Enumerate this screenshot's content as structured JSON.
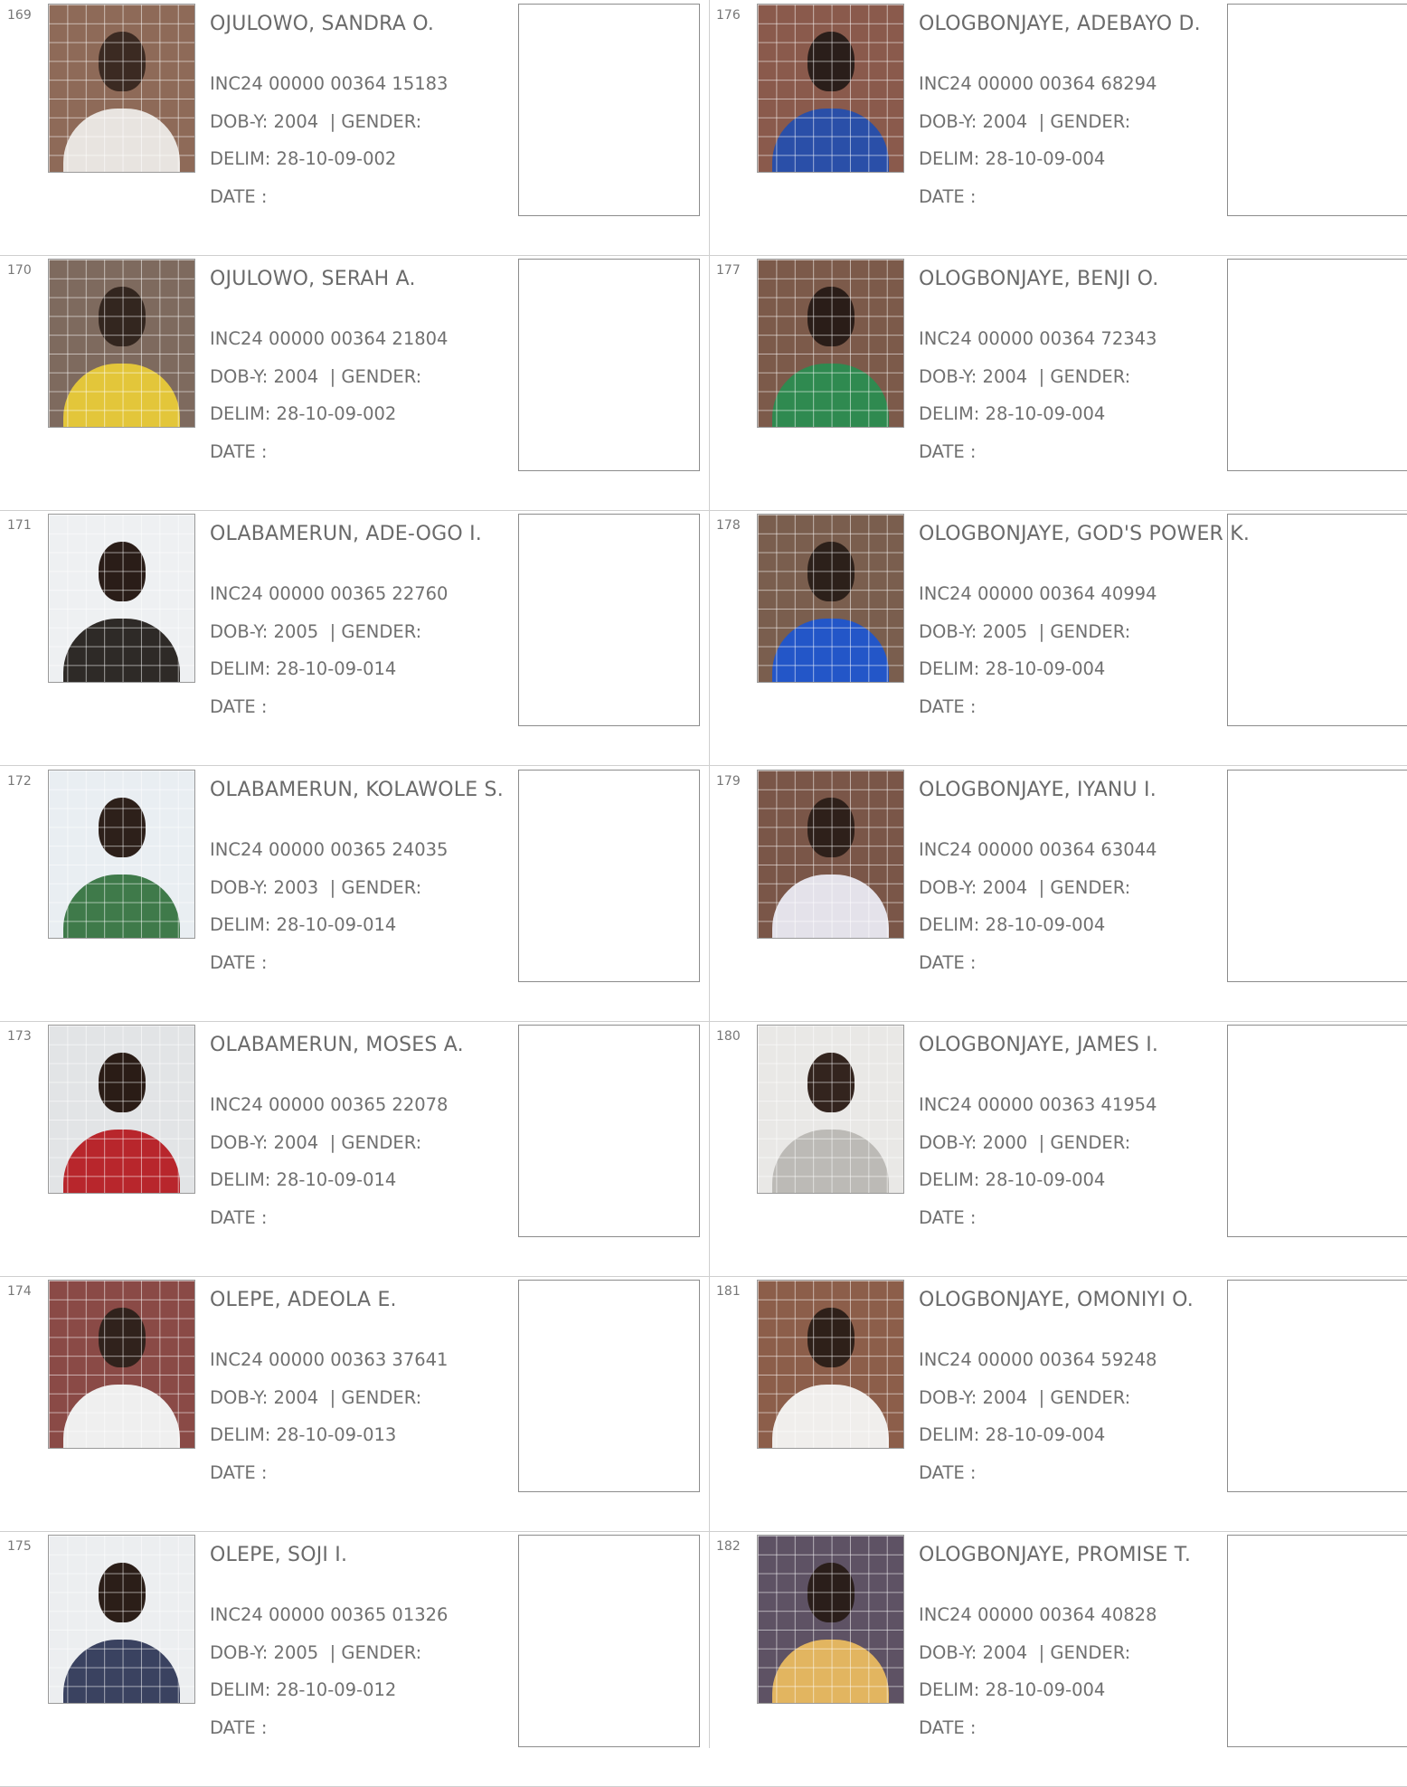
{
  "labels": {
    "dob_prefix": "DOB-Y: ",
    "gender_label": "| GENDER:",
    "delim_prefix": "DELIM: ",
    "date_label": "DATE  :"
  },
  "left_column": [
    {
      "serial": "169",
      "name": "OJULOWO, SANDRA O.",
      "vin": "INC24 00000 00364 15183",
      "dob": "DOB-Y: 2004",
      "gender": "| GENDER:",
      "delim": "DELIM: 28-10-09-002",
      "date": "DATE  :",
      "photo": {
        "bg": "#8e6a58",
        "head": "#3b2a22",
        "body": "#e8e4e0"
      }
    },
    {
      "serial": "170",
      "name": "OJULOWO, SERAH A.",
      "vin": "INC24 00000 00364 21804",
      "dob": "DOB-Y: 2004",
      "gender": "| GENDER:",
      "delim": "DELIM: 28-10-09-002",
      "date": "DATE  :",
      "photo": {
        "bg": "#7e6a5e",
        "head": "#33261f",
        "body": "#e3c63a"
      }
    },
    {
      "serial": "171",
      "name": "OLABAMERUN, ADE-OGO I.",
      "vin": "INC24 00000 00365 22760",
      "dob": "DOB-Y: 2005",
      "gender": "| GENDER:",
      "delim": "DELIM: 28-10-09-014",
      "date": "DATE  :",
      "photo": {
        "bg": "#eef0f2",
        "head": "#2a1d18",
        "body": "#2e2a27"
      }
    },
    {
      "serial": "172",
      "name": "OLABAMERUN, KOLAWOLE S.",
      "vin": "INC24 00000 00365 24035",
      "dob": "DOB-Y: 2003",
      "gender": "| GENDER:",
      "delim": "DELIM: 28-10-09-014",
      "date": "DATE  :",
      "photo": {
        "bg": "#e9eef2",
        "head": "#2d201a",
        "body": "#3f7a4a"
      }
    },
    {
      "serial": "173",
      "name": "OLABAMERUN, MOSES A.",
      "vin": "INC24 00000 00365 22078",
      "dob": "DOB-Y: 2004",
      "gender": "| GENDER:",
      "delim": "DELIM: 28-10-09-014",
      "date": "DATE  :",
      "photo": {
        "bg": "#e2e4e6",
        "head": "#2a1c16",
        "body": "#b8262c"
      }
    },
    {
      "serial": "174",
      "name": "OLEPE, ADEOLA E.",
      "vin": "INC24 00000 00363 37641",
      "dob": "DOB-Y: 2004",
      "gender": "| GENDER:",
      "delim": "DELIM: 28-10-09-013",
      "date": "DATE  :",
      "photo": {
        "bg": "#8a4a46",
        "head": "#30221c",
        "body": "#efefef"
      }
    },
    {
      "serial": "175",
      "name": "OLEPE, SOJI I.",
      "vin": "INC24 00000 00365 01326",
      "dob": "DOB-Y: 2005",
      "gender": "| GENDER:",
      "delim": "DELIM: 28-10-09-012",
      "date": "DATE  :",
      "photo": {
        "bg": "#eceef0",
        "head": "#2b1e18",
        "body": "#3a4260"
      }
    }
  ],
  "right_column": [
    {
      "serial": "176",
      "name": "OLOGBONJAYE, ADEBAYO D.",
      "vin": "INC24 00000 00364 68294",
      "dob": "DOB-Y: 2004",
      "gender": "| GENDER:",
      "delim": "DELIM: 28-10-09-004",
      "date": "DATE  :",
      "photo": {
        "bg": "#8a5a4c",
        "head": "#2a1e1a",
        "body": "#2a4fa8"
      }
    },
    {
      "serial": "177",
      "name": "OLOGBONJAYE, BENJI O.",
      "vin": "INC24 00000 00364 72343",
      "dob": "DOB-Y: 2004",
      "gender": "| GENDER:",
      "delim": "DELIM: 28-10-09-004",
      "date": "DATE  :",
      "photo": {
        "bg": "#7c5a4a",
        "head": "#2a1d18",
        "body": "#2f8a50"
      }
    },
    {
      "serial": "178",
      "name": "OLOGBONJAYE, GOD'S POWER K.",
      "vin": "INC24 00000 00364 40994",
      "dob": "DOB-Y: 2005",
      "gender": "| GENDER:",
      "delim": "DELIM: 28-10-09-004",
      "date": "DATE  :",
      "photo": {
        "bg": "#7a5e4e",
        "head": "#2c201a",
        "body": "#2356c8"
      }
    },
    {
      "serial": "179",
      "name": "OLOGBONJAYE, IYANU I.",
      "vin": "INC24 00000 00364 63044",
      "dob": "DOB-Y: 2004",
      "gender": "| GENDER:",
      "delim": "DELIM: 28-10-09-004",
      "date": "DATE  :",
      "photo": {
        "bg": "#7a5648",
        "head": "#2e201a",
        "body": "#e4e2ea"
      }
    },
    {
      "serial": "180",
      "name": "OLOGBONJAYE, JAMES I.",
      "vin": "INC24 00000 00363 41954",
      "dob": "DOB-Y: 2000",
      "gender": "| GENDER:",
      "delim": "DELIM: 28-10-09-004",
      "date": "DATE  :",
      "photo": {
        "bg": "#e9e8e6",
        "head": "#33241e",
        "body": "#bcbab6"
      }
    },
    {
      "serial": "181",
      "name": "OLOGBONJAYE, OMONIYI O.",
      "vin": "INC24 00000 00364 59248",
      "dob": "DOB-Y: 2004",
      "gender": "| GENDER:",
      "delim": "DELIM: 28-10-09-004",
      "date": "DATE  :",
      "photo": {
        "bg": "#8c5e4a",
        "head": "#2e2019",
        "body": "#f0eeec"
      }
    },
    {
      "serial": "182",
      "name": "OLOGBONJAYE, PROMISE T.",
      "vin": "INC24 00000 00364 40828",
      "dob": "DOB-Y: 2004",
      "gender": "| GENDER:",
      "delim": "DELIM: 28-10-09-004",
      "date": "DATE  :",
      "photo": {
        "bg": "#5e5264",
        "head": "#2a1e1a",
        "body": "#e2b560"
      }
    }
  ]
}
